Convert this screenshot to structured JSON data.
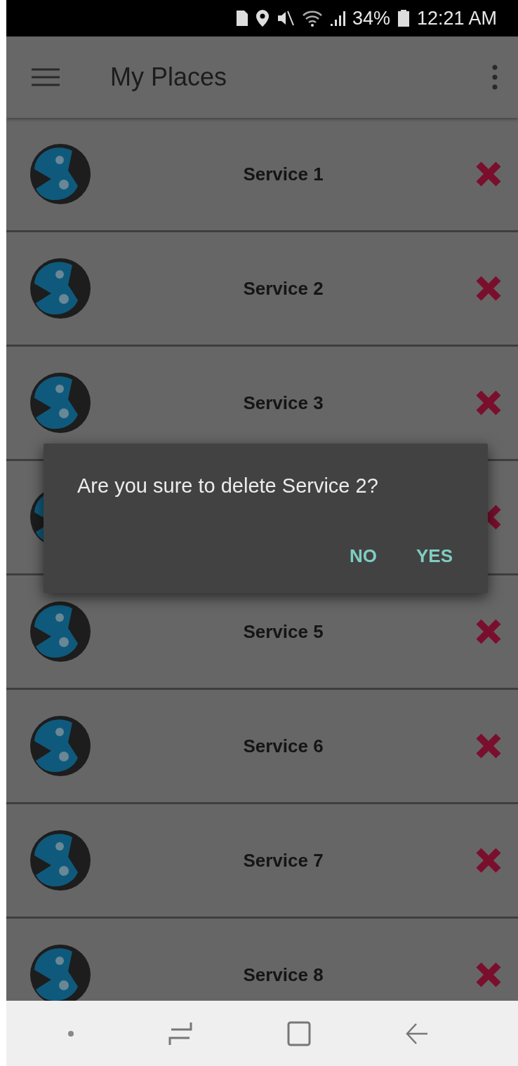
{
  "status_bar": {
    "battery": "34%",
    "time": "12:21 AM"
  },
  "app_bar": {
    "title": "My Places"
  },
  "rows": [
    {
      "label": "Service 1"
    },
    {
      "label": "Service 2"
    },
    {
      "label": "Service 3"
    },
    {},
    {
      "label": "Service 5"
    },
    {
      "label": "Service 6"
    },
    {
      "label": "Service 7"
    },
    {
      "label": "Service 8"
    }
  ],
  "dialog": {
    "message": "Are you sure to delete Service 2?",
    "buttons": [
      "NO",
      "YES"
    ]
  }
}
